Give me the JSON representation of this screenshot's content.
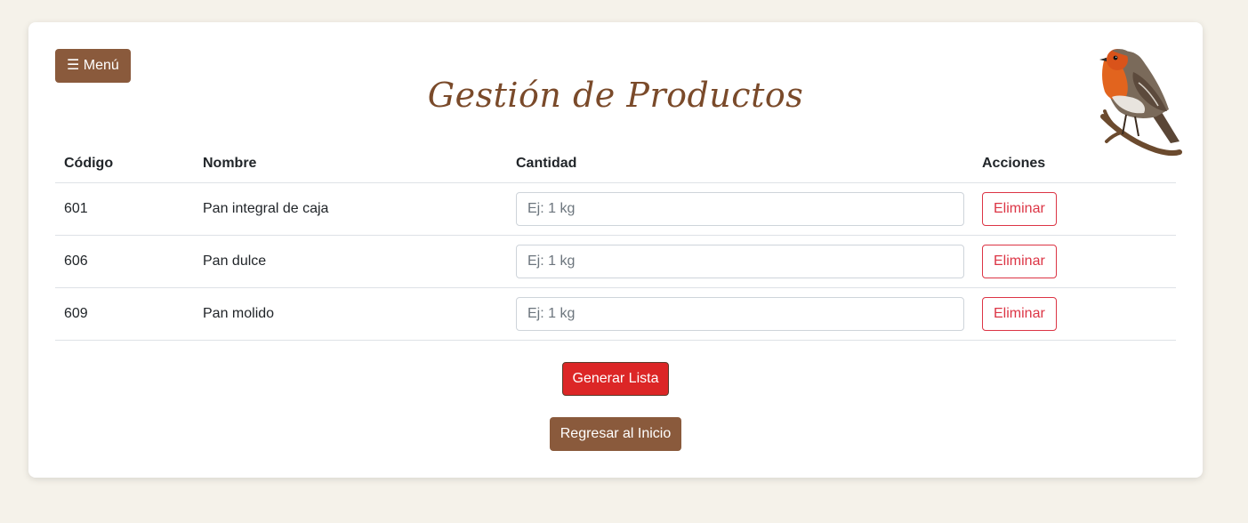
{
  "menu_button": {
    "icon": "hamburger-icon",
    "label": "☰ Menú"
  },
  "page_title": "Gestión de Productos",
  "table": {
    "headers": [
      "Código",
      "Nombre",
      "Cantidad",
      "Acciones"
    ],
    "rows": [
      {
        "code": "601",
        "name": "Pan integral de caja",
        "quantity_value": "",
        "quantity_placeholder": "Ej: 1 kg",
        "action_label": "Eliminar"
      },
      {
        "code": "606",
        "name": "Pan dulce",
        "quantity_value": "",
        "quantity_placeholder": "Ej: 1 kg",
        "action_label": "Eliminar"
      },
      {
        "code": "609",
        "name": "Pan molido",
        "quantity_value": "",
        "quantity_placeholder": "Ej: 1 kg",
        "action_label": "Eliminar"
      }
    ]
  },
  "generate_button": {
    "label": "Generar Lista"
  },
  "back_button": {
    "label": "Regresar al Inicio"
  },
  "colors": {
    "page_background": "#f5f2ea",
    "brown_accent": "#8a5a3c",
    "title_brown": "#7a4a2a",
    "danger_red": "#dc3545",
    "generate_red": "#dc2626"
  },
  "decoration": {
    "icon": "robin-bird-icon"
  }
}
